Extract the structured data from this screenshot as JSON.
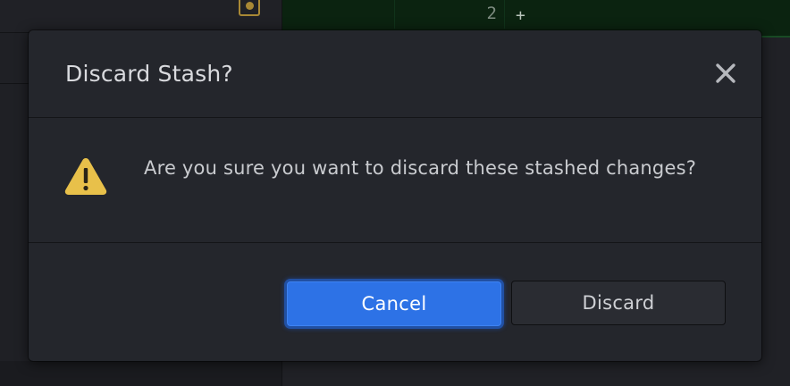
{
  "background": {
    "diff_line_number": "2",
    "diff_marker": "+"
  },
  "dialog": {
    "title": "Discard Stash?",
    "close_icon": "close-icon",
    "warning_icon": "warning-icon",
    "message": "Are you sure you want to discard these stashed changes?",
    "buttons": {
      "cancel_label": "Cancel",
      "discard_label": "Discard"
    }
  },
  "colors": {
    "accent": "#2d72e6",
    "warning": "#e8c04a",
    "dialog_bg": "#24262c",
    "diff_added_bg": "#0b2310"
  }
}
